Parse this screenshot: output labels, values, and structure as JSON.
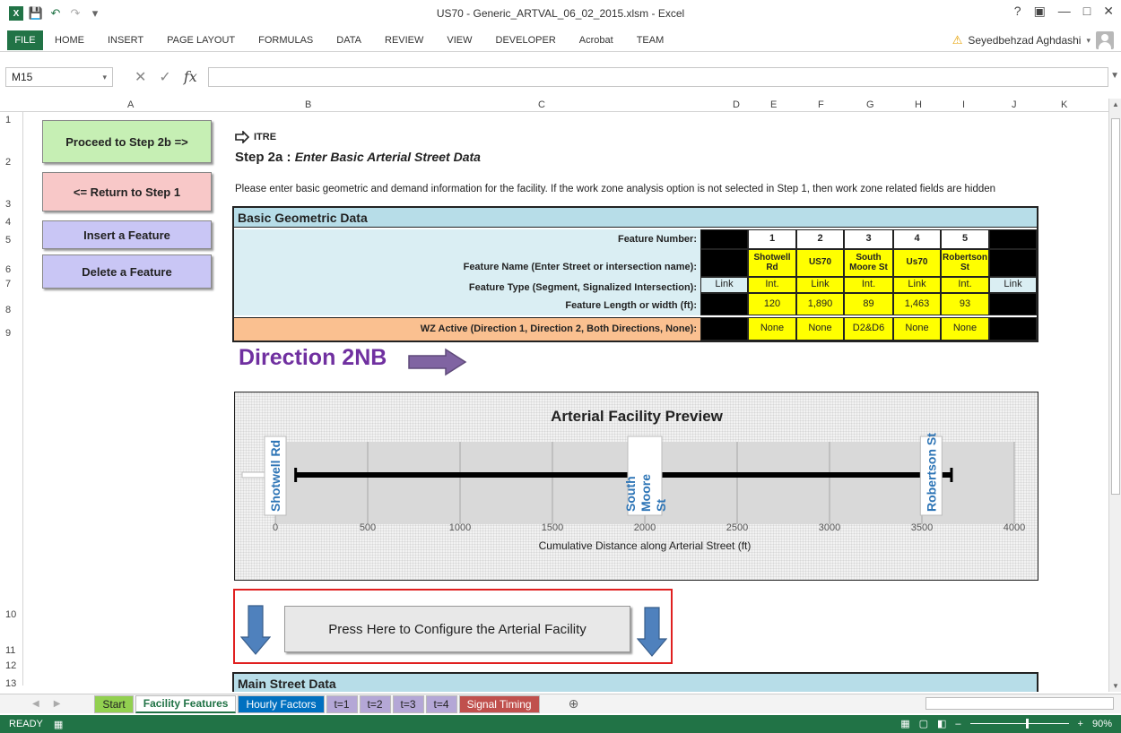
{
  "window": {
    "title": "US70 - Generic_ARTVAL_06_02_2015.xlsm - Excel"
  },
  "ribbon": {
    "file": "FILE",
    "tabs": [
      "HOME",
      "INSERT",
      "PAGE LAYOUT",
      "FORMULAS",
      "DATA",
      "REVIEW",
      "VIEW",
      "DEVELOPER",
      "Acrobat",
      "TEAM"
    ],
    "user": "Seyedbehzad Aghdashi"
  },
  "formula_bar": {
    "name_box": "M15",
    "fx": "fx",
    "value": ""
  },
  "columns": [
    "A",
    "B",
    "C",
    "D",
    "E",
    "F",
    "G",
    "H",
    "I",
    "J",
    "K"
  ],
  "rows": [
    "1",
    "2",
    "3",
    "4",
    "5",
    "6",
    "7",
    "8",
    "9",
    "10",
    "11",
    "12",
    "13"
  ],
  "buttons": {
    "proceed": "Proceed to Step 2b =>",
    "return": "<= Return to Step 1",
    "insert": "Insert a Feature",
    "delete": "Delete a Feature",
    "configure": "Press Here to Configure the Arterial Facility"
  },
  "heading": {
    "logo": "ITRE",
    "step": "Step 2a :",
    "step_title": "Enter Basic Arterial Street Data",
    "instructions": "Please enter basic geometric and demand information for the facility. If the work zone analysis option is not selected in Step 1, then  work zone related fields are hidden"
  },
  "geometric": {
    "header": "Basic Geometric Data",
    "labels": {
      "number": "Feature Number:",
      "name": "Feature Name (Enter Street or intersection name):",
      "type": "Feature Type (Segment, Signalized Intersection):",
      "length": "Feature Length or width (ft):",
      "wz": "WZ Active (Direction 1, Direction 2, Both Directions, None):"
    },
    "numbers": [
      "1",
      "2",
      "3",
      "4",
      "5"
    ],
    "names": [
      "Shotwell Rd",
      "US70",
      "South Moore St",
      "Us70",
      "Robertson St"
    ],
    "types": [
      "Link",
      "Int.",
      "Link",
      "Int.",
      "Link",
      "Int.",
      "Link"
    ],
    "lengths": [
      "120",
      "1,890",
      "89",
      "1,463",
      "93"
    ],
    "wz": [
      "None",
      "None",
      "D2&D6",
      "None",
      "None"
    ]
  },
  "direction": {
    "label": "Direction 2NB"
  },
  "chart_data": {
    "type": "line",
    "title": "Arterial Facility Preview",
    "xlabel": "Cumulative Distance along Arterial Street (ft)",
    "ylabel": "",
    "xlim": [
      0,
      4000
    ],
    "xticks": [
      "0",
      "500",
      "1000",
      "1500",
      "2000",
      "2500",
      "3000",
      "3500",
      "4000"
    ],
    "grid": true,
    "intersections": [
      {
        "name": "Shotwell Rd",
        "x": 0
      },
      {
        "name": "South Moore St",
        "x": 2000
      },
      {
        "name": "Robertson St",
        "x": 3550
      }
    ],
    "facility_range": [
      110,
      3660
    ]
  },
  "main_street": {
    "header": "Main Street Data"
  },
  "sheets": [
    "Start",
    "Facility Features",
    "Hourly Factors",
    "t=1",
    "t=2",
    "t=3",
    "t=4",
    "Signal Timing"
  ],
  "status": {
    "ready": "READY",
    "zoom": "90%"
  }
}
